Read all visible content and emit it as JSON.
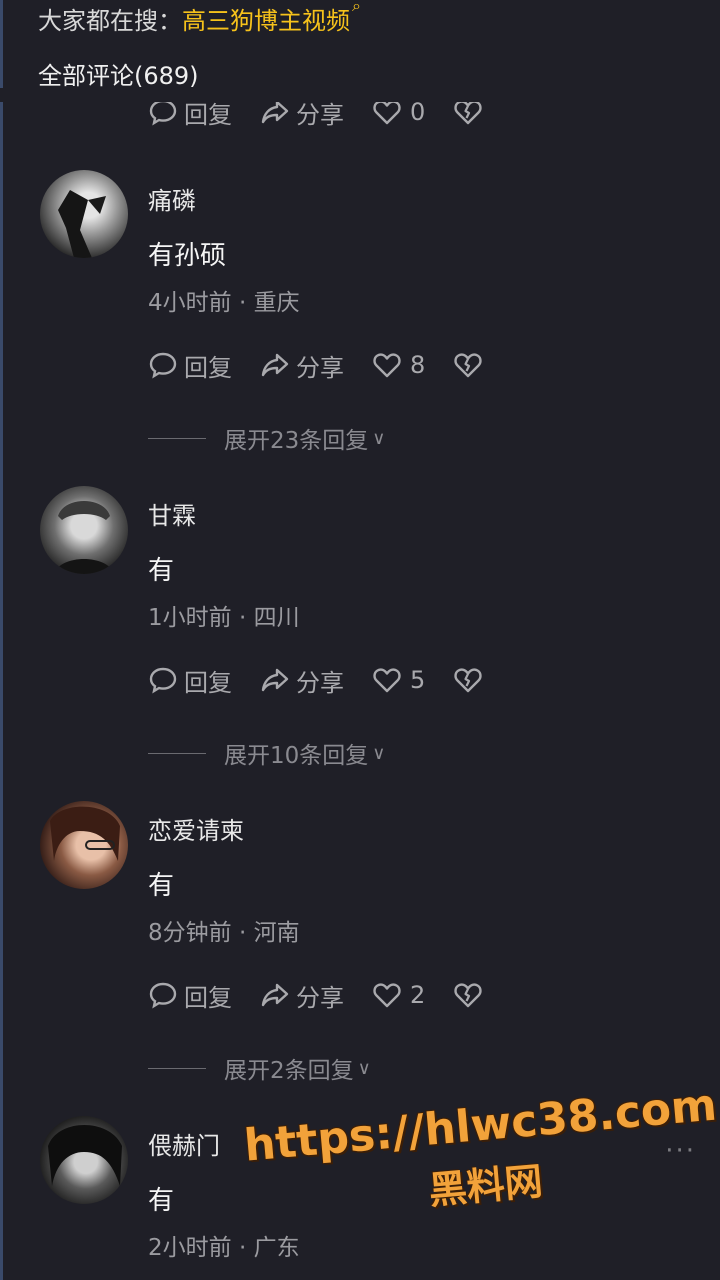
{
  "search_hint": {
    "prefix": "大家都在搜：",
    "term": "高三狗博主视频"
  },
  "comments_title": "全部评论(689)",
  "actions": {
    "reply": "回复",
    "share": "分享"
  },
  "partial_row": {
    "likes": "0"
  },
  "comments": [
    {
      "username": "痛磷",
      "content": "有孙硕",
      "meta": "4小时前 · 重庆",
      "likes": "8",
      "expand": "展开23条回复"
    },
    {
      "username": "甘霖",
      "content": "有",
      "meta": "1小时前 · 四川",
      "likes": "5",
      "expand": "展开10条回复"
    },
    {
      "username": "恋爱请柬",
      "content": "有",
      "meta": "8分钟前 · 河南",
      "likes": "2",
      "expand": "展开2条回复"
    },
    {
      "username": "偎赫门",
      "content": "有",
      "meta": "2小时前 · 广东"
    }
  ],
  "more_icon": "···",
  "watermark": {
    "url": "https://hlwc38.com",
    "name": "黑料网"
  },
  "colors": {
    "background": "#1f1f27",
    "accent": "#f6c21b",
    "watermark": "#f2a23a"
  }
}
